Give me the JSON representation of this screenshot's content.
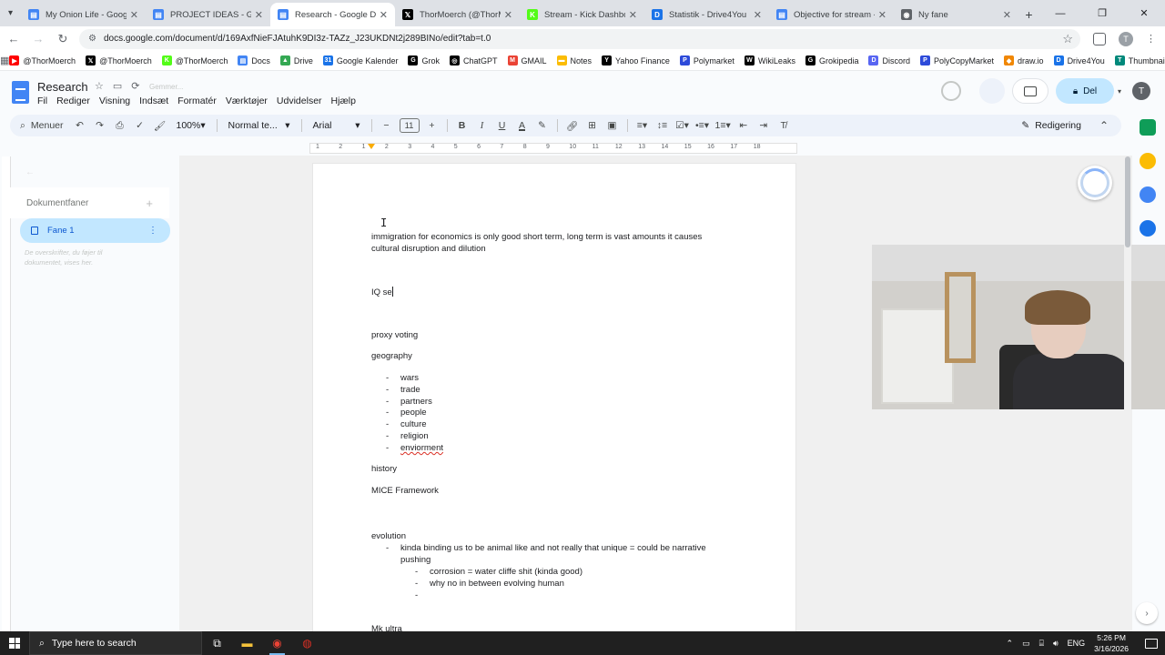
{
  "browser": {
    "tabs": [
      {
        "title": "My Onion Life - Google Docs",
        "fav_color": "#4285f4",
        "fav_glyph": "▤"
      },
      {
        "title": "PROJECT IDEAS - Google Docs",
        "fav_color": "#4285f4",
        "fav_glyph": "▤"
      },
      {
        "title": "Research - Google Docs",
        "fav_color": "#4285f4",
        "fav_glyph": "▤"
      },
      {
        "title": "ThorMoerch (@ThorMoerch) / X",
        "fav_color": "#000000",
        "fav_glyph": "𝕏"
      },
      {
        "title": "Stream - Kick Dashboard",
        "fav_color": "#53fc18",
        "fav_glyph": "K"
      },
      {
        "title": "Statistik - Drive4You",
        "fav_color": "#1a73e8",
        "fav_glyph": "D"
      },
      {
        "title": "Objective for stream - Google Docs",
        "fav_color": "#4285f4",
        "fav_glyph": "▤"
      },
      {
        "title": "Ny fane",
        "fav_color": "#5f6368",
        "fav_glyph": "◉"
      }
    ],
    "url": "docs.google.com/document/d/169AxfNieFJAtuhK9DI3z-TAZz_J23UKDNt2j289BINo/edit?tab=t.0",
    "profile_initial": "T",
    "bookmarks": [
      {
        "label": "@ThorMoerch",
        "color": "#ff0000",
        "glyph": "▶"
      },
      {
        "label": "@ThorMoerch",
        "color": "#000000",
        "glyph": "𝕏"
      },
      {
        "label": "@ThorMoerch",
        "color": "#53fc18",
        "glyph": "K"
      },
      {
        "label": "Docs",
        "color": "#4285f4",
        "glyph": "▤"
      },
      {
        "label": "Drive",
        "color": "#34a853",
        "glyph": "▲"
      },
      {
        "label": "Google Kalender",
        "color": "#1a73e8",
        "glyph": "31"
      },
      {
        "label": "Grok",
        "color": "#000000",
        "glyph": "G"
      },
      {
        "label": "ChatGPT",
        "color": "#000000",
        "glyph": "◎"
      },
      {
        "label": "GMAIL",
        "color": "#ea4335",
        "glyph": "M"
      },
      {
        "label": "Notes",
        "color": "#fbbc04",
        "glyph": "▬"
      },
      {
        "label": "Yahoo Finance",
        "color": "#000000",
        "glyph": "Y"
      },
      {
        "label": "Polymarket",
        "color": "#2d4ad9",
        "glyph": "P"
      },
      {
        "label": "WikiLeaks",
        "color": "#000000",
        "glyph": "W"
      },
      {
        "label": "Grokipedia",
        "color": "#000000",
        "glyph": "G"
      },
      {
        "label": "Discord",
        "color": "#5865f2",
        "glyph": "D"
      },
      {
        "label": "PolyCopyMarket",
        "color": "#2d4ad9",
        "glyph": "P"
      },
      {
        "label": "draw.io",
        "color": "#f08705",
        "glyph": "◆"
      },
      {
        "label": "Drive4You",
        "color": "#1a73e8",
        "glyph": "D"
      },
      {
        "label": "Thumbnail maker",
        "color": "#00897b",
        "glyph": "T"
      }
    ]
  },
  "docs": {
    "title": "Research",
    "saving": "Gemmer...",
    "menus": [
      "Fil",
      "Rediger",
      "Visning",
      "Indsæt",
      "Formatér",
      "Værktøjer",
      "Udvidelser",
      "Hjælp"
    ],
    "share_label": "Del",
    "avatar_initial": "T",
    "toolbar": {
      "menu_label": "Menuer",
      "zoom": "100%",
      "style": "Normal te...",
      "font": "Arial",
      "font_size": "11",
      "editing_label": "Redigering"
    },
    "sidebar": {
      "tabs_title": "Dokumentfaner",
      "tab_name": "Fane 1",
      "hint": "De overskrifter, du føjer til dokumentet, vises her."
    },
    "ruler": [
      "1",
      "2",
      "1",
      "2",
      "3",
      "4",
      "5",
      "6",
      "7",
      "8",
      "9",
      "10",
      "11",
      "12",
      "13",
      "14",
      "15",
      "16",
      "17",
      "18"
    ]
  },
  "document": {
    "p1_line1": "immigration for economics is only good short term, long term is vast amounts it causes",
    "p1_line2": "cultural disruption and dilution",
    "iq": "IQ se",
    "proxy": "proxy voting",
    "geography": "geography",
    "geo_items": [
      "wars",
      "trade",
      "partners",
      "people",
      "culture",
      "religion",
      "enviorment"
    ],
    "history": "history",
    "mice": "MICE Framework",
    "evolution": "evolution",
    "evo_line1": "kinda binding us to be animal like and not really that unique = could be narrative",
    "evo_line2": "pushing",
    "evo_sub": [
      "corrosion = water cliffe shit (kinda good)",
      "why no in between evolving human",
      ""
    ],
    "mk": "Mk ultra",
    "dash": "-"
  },
  "taskbar": {
    "search_placeholder": "Type here to search",
    "lang": "ENG",
    "time": "5:26 PM",
    "date": "3/16/2026"
  }
}
